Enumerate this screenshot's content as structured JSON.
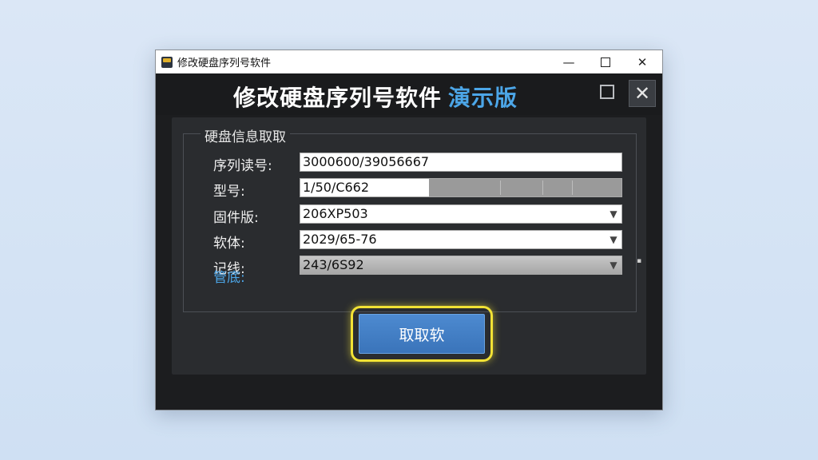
{
  "window": {
    "titlebar_text": "修改硬盘序列号软件",
    "controls": {
      "minimize": "—",
      "close": "✕"
    }
  },
  "header": {
    "title": "修改硬盘序列号软件",
    "title_accent": "演示版",
    "close_glyph": "✕"
  },
  "group": {
    "legend": "硬盘信息取取",
    "rows": [
      {
        "label": "序列读号:",
        "value": "3000600/39056667"
      },
      {
        "label": "型号:",
        "value": "1/50/C662"
      },
      {
        "label": "固件版:",
        "value": "206XP503"
      },
      {
        "label": "软体:",
        "value": "2029/65-76"
      },
      {
        "label": "记线:",
        "value": "243/6S92"
      }
    ],
    "blue_label": "管底:"
  },
  "action_button": {
    "label": "取取软"
  },
  "colors": {
    "accent": "#4ca6e8",
    "button": "#3a74ba",
    "highlight": "#f2e235"
  },
  "icons": [
    "app-icon",
    "chevron-down-icon",
    "restore-icon",
    "close-icon"
  ]
}
